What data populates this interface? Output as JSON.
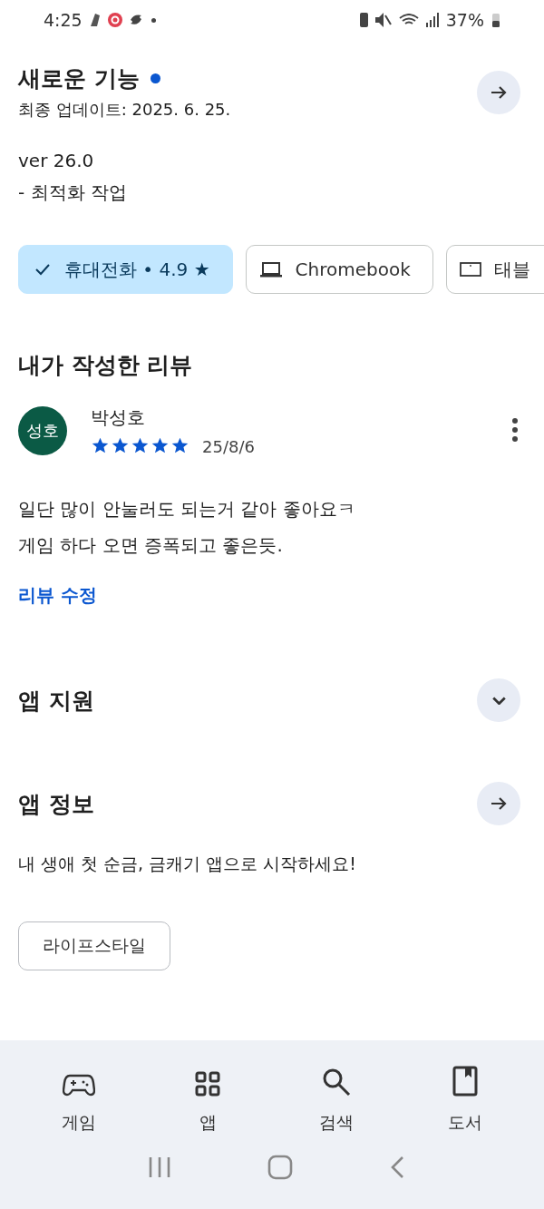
{
  "status_bar": {
    "time": "4:25",
    "battery": "37%"
  },
  "whats_new": {
    "title": "새로운 기능",
    "has_new": true,
    "updated": "최종 업데이트: 2025. 6. 25.",
    "lines": [
      "ver 26.0",
      "- 최적화 작업"
    ]
  },
  "device_chips": [
    {
      "label": "휴대전화 • 4.9 ★",
      "selected": true
    },
    {
      "label": "Chromebook",
      "kind": "laptop",
      "selected": false
    },
    {
      "label": "태블",
      "kind": "tablet",
      "selected": false
    }
  ],
  "my_review": {
    "heading": "내가 작성한 리뷰",
    "avatar_text": "성호",
    "author": "박성호",
    "stars": 5,
    "date": "25/8/6",
    "text": "일단 많이 안눌러도 되는거 같아 좋아요ㅋ\n게임 하다 오면 증폭되고 좋은듯.",
    "edit_link": "리뷰 수정"
  },
  "app_support": {
    "title": "앱 지원",
    "expanded": false
  },
  "app_info": {
    "title": "앱 정보",
    "description": "내 생애 첫 순금, 금캐기 앱으로 시작하세요!",
    "tags": [
      "라이프스타일"
    ]
  },
  "bottom_nav": [
    {
      "label": "게임",
      "kind": "games"
    },
    {
      "label": "앱",
      "kind": "apps"
    },
    {
      "label": "검색",
      "kind": "search"
    },
    {
      "label": "도서",
      "kind": "books"
    }
  ]
}
